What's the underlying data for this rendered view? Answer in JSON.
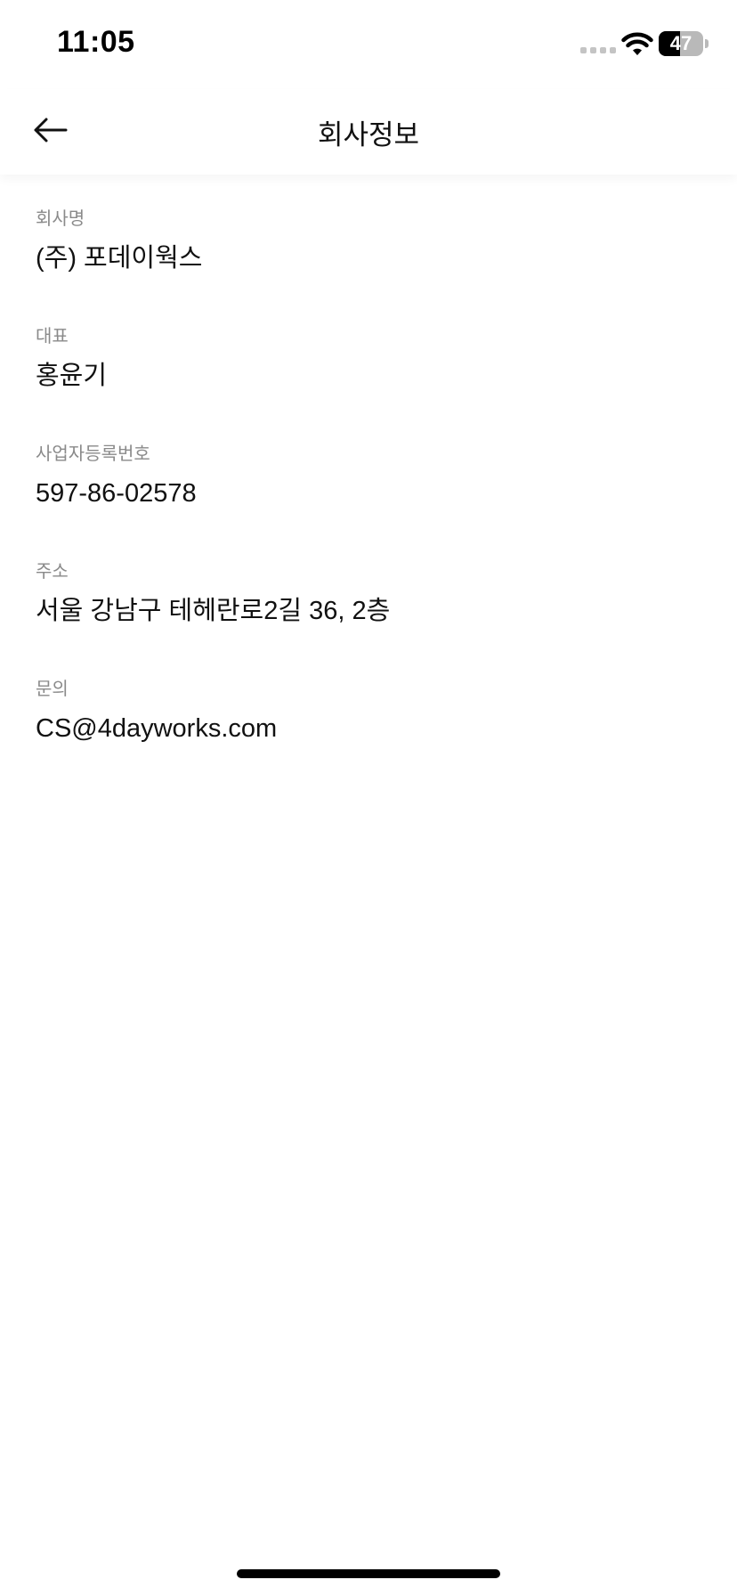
{
  "status_bar": {
    "time": "11:05",
    "battery_level": 47,
    "battery_text": "47"
  },
  "header": {
    "title": "회사정보",
    "back_icon": "arrow-left-icon"
  },
  "company_info": [
    {
      "label": "회사명",
      "value": "(주) 포데이웍스"
    },
    {
      "label": "대표",
      "value": "홍윤기"
    },
    {
      "label": "사업자등록번호",
      "value": "597-86-02578"
    },
    {
      "label": "주소",
      "value": "서울 강남구 테헤란로2길 36, 2층"
    },
    {
      "label": "문의",
      "value": "CS@4dayworks.com"
    }
  ]
}
